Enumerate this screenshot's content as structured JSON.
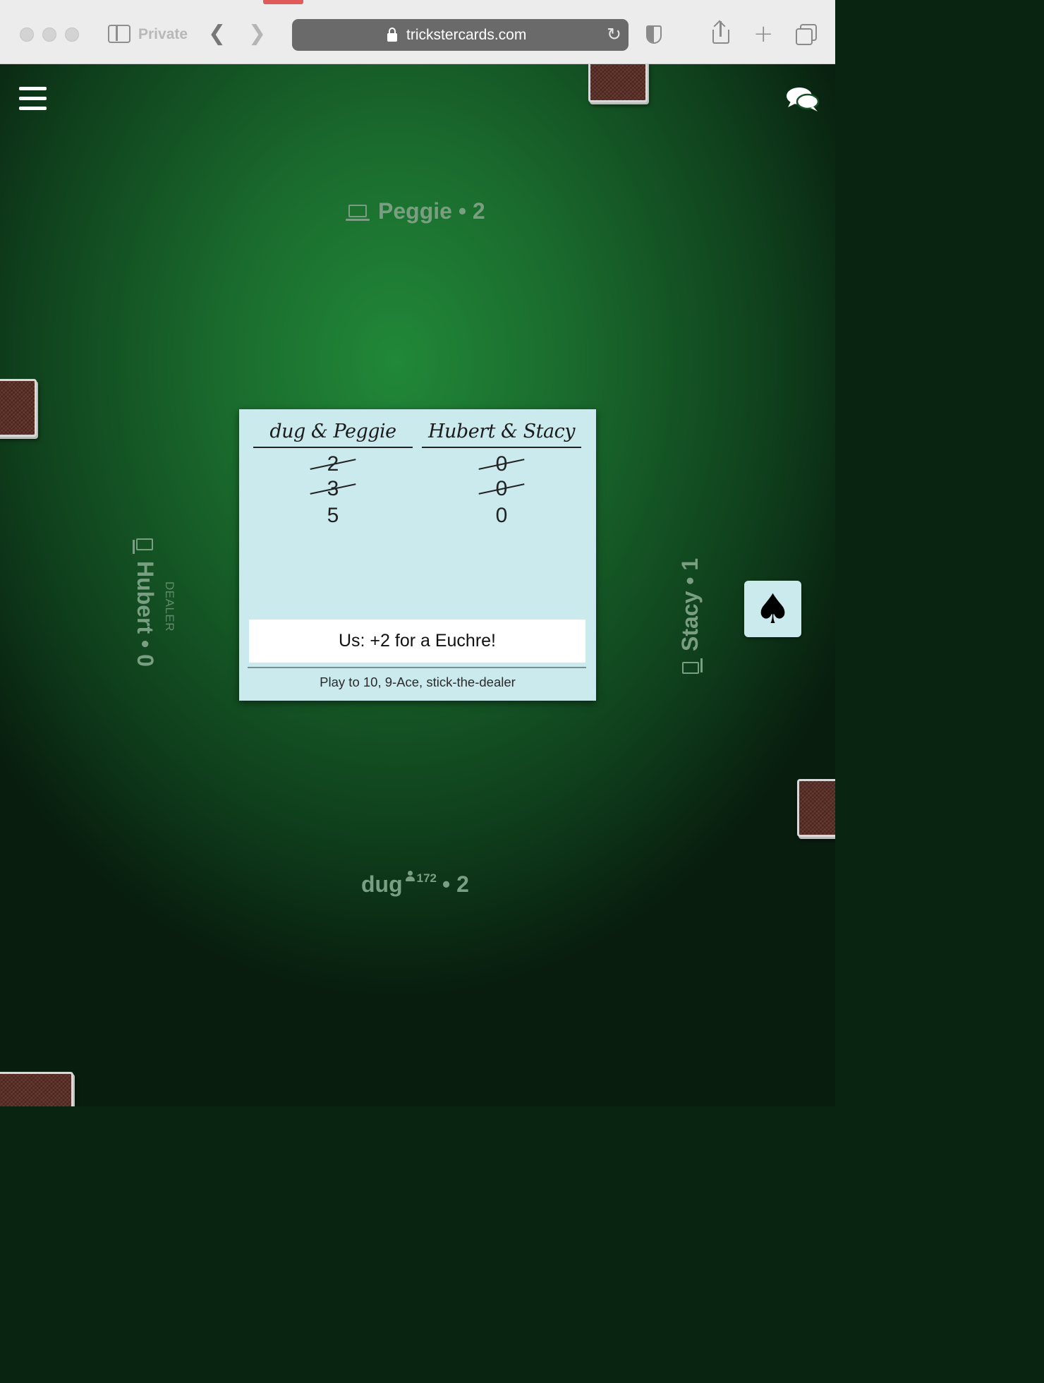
{
  "browser": {
    "private_label": "Private",
    "url": "trickstercards.com"
  },
  "players": {
    "top": {
      "name": "Peggie",
      "score_text": "Peggie • 2",
      "device": "laptop-icon"
    },
    "left": {
      "name": "Hubert",
      "score_text": "Hubert • 0",
      "role": "DEALER",
      "device": "tablet-icon"
    },
    "right": {
      "name": "Stacy",
      "score_text": "Stacy • 1",
      "device": "tablet-icon"
    },
    "bottom": {
      "name": "dug",
      "rating": "172",
      "score_suffix": "• 2"
    }
  },
  "scoreboard": {
    "teams": [
      {
        "name": "dug & Peggie",
        "struck_scores": [
          "2",
          "3"
        ],
        "current": "5"
      },
      {
        "name": "Hubert & Stacy",
        "struck_scores": [
          "0",
          "0"
        ],
        "current": "0"
      }
    ],
    "message": "Us: +2 for a Euchre!",
    "rules": "Play to 10, 9-Ace, stick-the-dealer"
  },
  "trump": {
    "suit": "♠",
    "icon": "spade-icon"
  },
  "colors": {
    "felt": "#218838",
    "panel": "#cbeaee",
    "player_label": "#7a9e82",
    "card_back": "#5a2d24"
  }
}
